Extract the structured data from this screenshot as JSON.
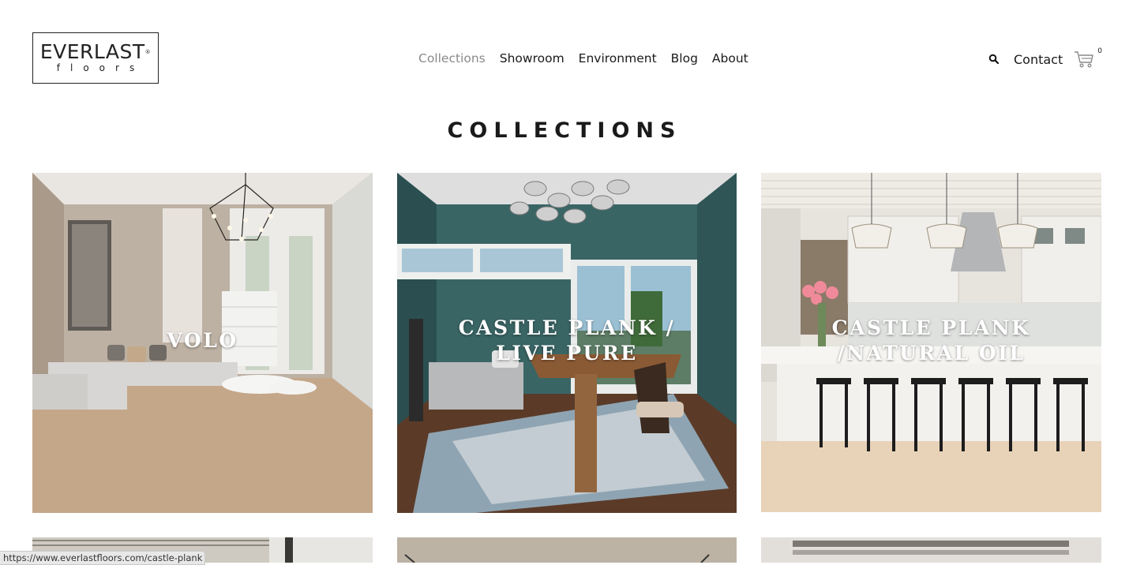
{
  "logo": {
    "brand": "EVERLAST",
    "registered": "®",
    "sub": "floors"
  },
  "nav": {
    "items": [
      {
        "label": "Collections"
      },
      {
        "label": "Showroom"
      },
      {
        "label": "Environment"
      },
      {
        "label": "Blog"
      },
      {
        "label": "About"
      }
    ]
  },
  "tools": {
    "contact_label": "Contact",
    "cart_count": "0"
  },
  "page": {
    "title": "COLLECTIONS"
  },
  "collections": [
    {
      "label": "VOLO"
    },
    {
      "label": "CASTLE PLANK / LIVE PURE"
    },
    {
      "label": "CASTLE PLANK /NATURAL OIL"
    }
  ],
  "status": {
    "url": "https://www.everlastfloors.com/castle-plank"
  },
  "colors": {
    "nav_active": "#8a8a8a",
    "text": "#1a1a1a",
    "background": "#ffffff"
  }
}
